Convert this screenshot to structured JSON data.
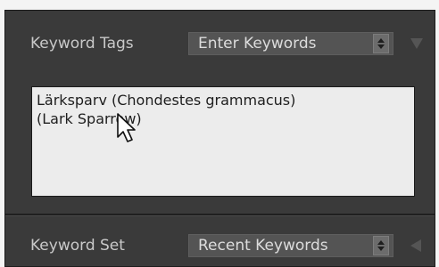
{
  "keyword_tags": {
    "label": "Keyword Tags",
    "mode_select": "Enter Keywords",
    "text_lines": [
      "Lärksparv (Chondestes grammacus)",
      "(Lark Sparrow)"
    ]
  },
  "keyword_set": {
    "label": "Keyword Set",
    "set_select": "Recent Keywords"
  },
  "colors": {
    "panel_bg": "#3a3a3a",
    "field_bg": "#ececec",
    "label_text": "#c9c9c9"
  },
  "icons": {
    "stepper": "up-down-stepper-icon",
    "collapse_triangle": "triangle-down-icon",
    "expand_triangle": "triangle-left-icon",
    "cursor": "mouse-pointer-icon"
  }
}
